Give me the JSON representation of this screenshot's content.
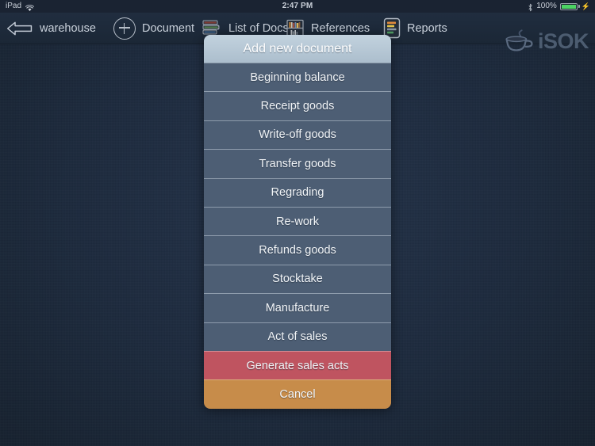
{
  "statusbar": {
    "device": "iPad",
    "wifi_icon": "wifi-icon",
    "time": "2:47 PM",
    "bluetooth_icon": "bluetooth-icon",
    "battery_percent": "100%",
    "battery_icon": "battery-charging-icon"
  },
  "navbar": {
    "back": {
      "icon": "back-arrow-icon",
      "label": "warehouse"
    },
    "items": [
      {
        "icon": "plus-circle-icon",
        "label": "Document"
      },
      {
        "icon": "books-stack-icon",
        "label": "List of Docs"
      },
      {
        "icon": "bookshelf-icon",
        "label": "References"
      },
      {
        "icon": "report-bars-icon",
        "label": "Reports"
      }
    ],
    "logo": {
      "icon": "coffee-cup-icon",
      "text": "iSOK"
    }
  },
  "action_sheet": {
    "title": "Add new document",
    "items": [
      {
        "label": "Beginning balance",
        "style": "normal"
      },
      {
        "label": "Receipt goods",
        "style": "normal"
      },
      {
        "label": "Write-off goods",
        "style": "normal"
      },
      {
        "label": "Transfer goods",
        "style": "normal"
      },
      {
        "label": "Regrading",
        "style": "normal"
      },
      {
        "label": "Re-work",
        "style": "normal"
      },
      {
        "label": "Refunds goods",
        "style": "normal"
      },
      {
        "label": "Stocktake",
        "style": "normal"
      },
      {
        "label": "Manufacture",
        "style": "normal"
      },
      {
        "label": "Act of sales",
        "style": "normal"
      },
      {
        "label": "Generate sales acts",
        "style": "danger"
      },
      {
        "label": "Cancel",
        "style": "cancel"
      }
    ]
  },
  "colors": {
    "background": "#1c2a3d",
    "navbar": "#1e2b3c",
    "sheet_header": "#b3c5d3",
    "sheet_item": "#4d5e74",
    "danger": "#bf5460",
    "cancel": "#c78c4a",
    "battery_green": "#4cd464"
  }
}
